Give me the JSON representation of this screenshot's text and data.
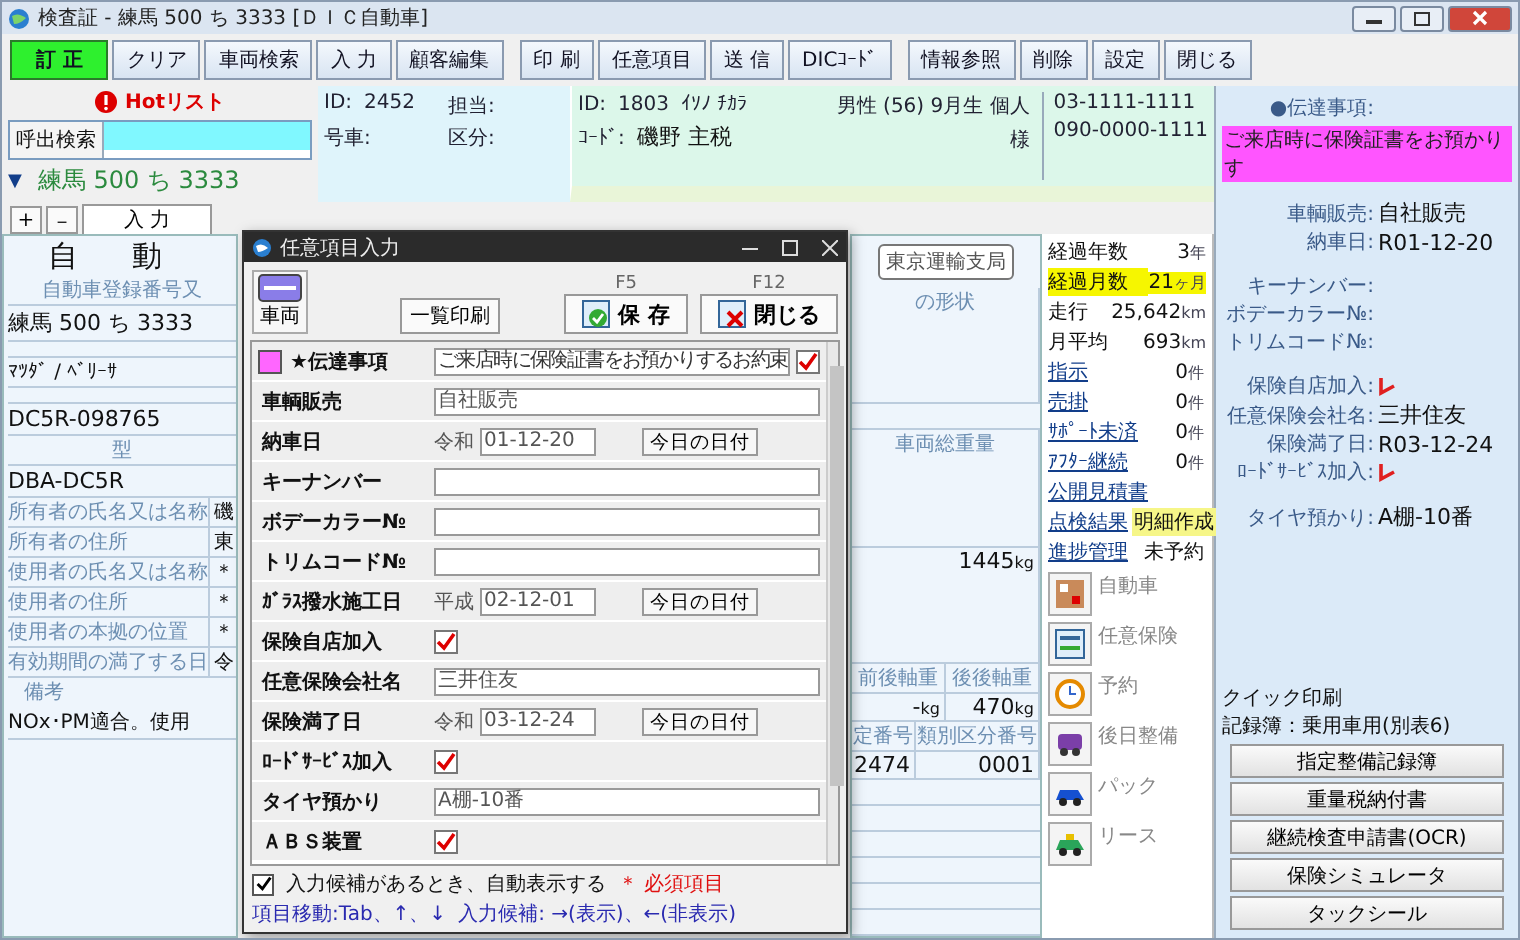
{
  "window": {
    "title": "検査証 - 練馬 500 ち 3333 [ＤＩＣ自動車]"
  },
  "toolbar": [
    {
      "buttons": [
        {
          "label": "訂 正",
          "selected": true
        },
        {
          "label": "クリア",
          "selected": false
        },
        {
          "label": "車両検索",
          "selected": false
        },
        {
          "label": "入 力",
          "selected": false
        },
        {
          "label": "顧客編集",
          "selected": false
        }
      ]
    },
    {
      "buttons": [
        {
          "label": "印 刷",
          "selected": false
        },
        {
          "label": "任意項目",
          "selected": false
        },
        {
          "label": "送 信",
          "selected": false
        },
        {
          "label": "DICｺｰﾄﾞ",
          "selected": false
        }
      ]
    },
    {
      "buttons": [
        {
          "label": "情報参照",
          "selected": false
        },
        {
          "label": "削除",
          "selected": false
        },
        {
          "label": "設定",
          "selected": false
        },
        {
          "label": "閉じる",
          "selected": false
        }
      ]
    }
  ],
  "search": {
    "hotlist": "Hotリスト",
    "label": "呼出検索"
  },
  "plate": {
    "marker": "▼",
    "text": "練馬 500 ち 3333"
  },
  "view_buttons": [
    "+",
    "－"
  ],
  "tabs": [
    {
      "label": "入 力",
      "selected": true
    }
  ],
  "vehicle_info": [
    {
      "label": "ID:",
      "value": "2452"
    },
    {
      "label": "担当:"
    },
    {
      "label": "号車:"
    },
    {
      "label": "区分:"
    }
  ],
  "customer": {
    "id_label": "ID:",
    "id": "1803",
    "code_label": "ｺｰﾄﾞ:",
    "kana": "ｲｿﾉ ﾁｶﾗ",
    "name": "磯野 主税",
    "profile": "男性 (56) 9月生 個人",
    "honorific": "様",
    "phones": [
      "03-1111-1111",
      "090-0000-1111"
    ]
  },
  "certificate": {
    "heading": "自　動",
    "reg_label": "自動車登録番号又",
    "plate": "練馬 500 ち 3333",
    "make": "ﾏﾂﾀﾞ / ﾍﾞﾘｰｻ",
    "chassis": "DC5R-098765",
    "type_label": "型",
    "model": "DBA-DC5R",
    "rows": [
      {
        "label": "所有者の氏名又は名称",
        "value": "磯"
      },
      {
        "label": "所有者の住所",
        "value": "東"
      },
      {
        "label": "使用者の氏名又は名称",
        "value": "＊"
      },
      {
        "label": "使用者の住所",
        "value": "＊"
      },
      {
        "label": "使用者の本拠の位置",
        "value": "＊"
      },
      {
        "label": "有効期間の満了する日",
        "value": "令"
      }
    ],
    "remarks_label": "備考",
    "remarks": "NOx･PM適合。使用",
    "office": "東京運輸支局",
    "shape_label": "の形状",
    "gross_label": "車両総重量",
    "gross": "1445",
    "gross_unit": "kg",
    "axles": [
      {
        "label": "前後軸重",
        "value": "-",
        "unit": "kg"
      },
      {
        "label": "後後軸重",
        "value": "470",
        "unit": "kg"
      }
    ],
    "numbers": [
      {
        "label": "定番号",
        "value": "2474"
      },
      {
        "label": "類別区分番号",
        "value": "0001"
      }
    ]
  },
  "stats": [
    {
      "label": "経過年数",
      "value": "3",
      "unit": "年",
      "highlight": false
    },
    {
      "label": "経過月数",
      "value": "21",
      "unit": "ヶ月",
      "highlight": true
    },
    {
      "label": "走行",
      "value": "25,642",
      "unit": "km",
      "highlight": false
    },
    {
      "label": "月平均",
      "value": "693",
      "unit": "km",
      "highlight": false
    }
  ],
  "links": [
    {
      "label": "指示",
      "value": "0",
      "unit": "件",
      "highlight": false
    },
    {
      "label": "売掛",
      "value": "0",
      "unit": "件",
      "highlight": false
    },
    {
      "label": "ｻﾎﾟｰﾄ未済",
      "value": "0",
      "unit": "件",
      "highlight": false
    },
    {
      "label": "ｱﾌﾀｰ継続",
      "value": "0",
      "unit": "件",
      "highlight": false
    },
    {
      "label": "公開見積書"
    },
    {
      "label": "点検結果",
      "value": "明細作成",
      "highlight": true
    },
    {
      "label": "進捗管理",
      "value": "未予約",
      "highlight": false
    }
  ],
  "apps": [
    {
      "kind": "calc",
      "label": "自動車"
    },
    {
      "kind": "form",
      "label": "任意保険"
    },
    {
      "kind": "clock",
      "label": "予約"
    },
    {
      "kind": "van",
      "label": "後日整備"
    },
    {
      "kind": "car",
      "label": "パック"
    },
    {
      "kind": "taxi",
      "label": "リース"
    }
  ],
  "dialog": {
    "title": "任意項目入力",
    "vehicle_button": "車両",
    "print_button": "一覧印刷",
    "save": {
      "key": "F5",
      "label": "保 存"
    },
    "close": {
      "key": "F12",
      "label": "閉じる"
    },
    "rows": [
      {
        "kind": "note",
        "label": "★伝達事項",
        "value": "ご来店時に保険証書をお預かりするお約束",
        "checked": true
      },
      {
        "kind": "text",
        "label": "車輌販売",
        "value": "自社販売"
      },
      {
        "kind": "date",
        "label": "納車日",
        "era": "令和",
        "value": "01-12-20",
        "button": "今日の日付"
      },
      {
        "kind": "text",
        "label": "キーナンバー"
      },
      {
        "kind": "text",
        "label": "ボデーカラー№"
      },
      {
        "kind": "text",
        "label": "トリムコード№"
      },
      {
        "kind": "date",
        "label": "ｶﾞﾗｽ撥水施工日",
        "era": "平成",
        "value": "02-12-01",
        "button": "今日の日付"
      },
      {
        "kind": "check",
        "label": "保険自店加入",
        "checked": true
      },
      {
        "kind": "text",
        "label": "任意保険会社名",
        "value": "三井住友"
      },
      {
        "kind": "date",
        "label": "保険満了日",
        "era": "令和",
        "value": "03-12-24",
        "button": "今日の日付"
      },
      {
        "kind": "check",
        "label": "ﾛｰﾄﾞｻｰﾋﾞｽ加入",
        "checked": true
      },
      {
        "kind": "text",
        "label": "タイヤ預かり",
        "value": "A棚-10番"
      },
      {
        "kind": "check",
        "label": "ＡＢＳ装置",
        "checked": true
      }
    ],
    "footer": {
      "auto_label": "入力候補があるとき、自動表示する",
      "checked": true,
      "required": "＊ 必須項目",
      "move_hint": "項目移動:Tab、↑、↓",
      "candidate_hint": "入力候補: →(表示)、←(非表示)"
    }
  },
  "side_panel": {
    "groups": [
      [
        {
          "kind": "note",
          "label": "●伝達事項:",
          "value": "ご来店時に保険証書をお預かりす"
        }
      ],
      [
        {
          "kind": "text",
          "label": "車輌販売:",
          "value": "自社販売"
        },
        {
          "kind": "text",
          "label": "納車日:",
          "value": "R01-12-20"
        }
      ],
      [
        {
          "kind": "text",
          "label": "キーナンバー:"
        },
        {
          "kind": "text",
          "label": "ボデーカラー№:"
        },
        {
          "kind": "text",
          "label": "トリムコード№:"
        }
      ],
      [
        {
          "kind": "check",
          "label": "保険自店加入:",
          "checked": true
        },
        {
          "kind": "text",
          "label": "任意保険会社名:",
          "value": "三井住友"
        },
        {
          "kind": "text",
          "label": "保険満了日:",
          "value": "R03-12-24"
        },
        {
          "kind": "check",
          "label": "ﾛｰﾄﾞｻｰﾋﾞｽ加入:",
          "checked": true
        }
      ],
      [
        {
          "kind": "text",
          "label": "タイヤ預かり:",
          "value": "A棚-10番"
        }
      ]
    ],
    "quick_print": {
      "label": "クイック印刷",
      "record": "記録簿：乗用車用(別表6)",
      "buttons": [
        "指定整備記録簿",
        "重量税納付書",
        "継続検査申請書(OCR)",
        "保険シミュレータ",
        "タックシール"
      ]
    }
  }
}
